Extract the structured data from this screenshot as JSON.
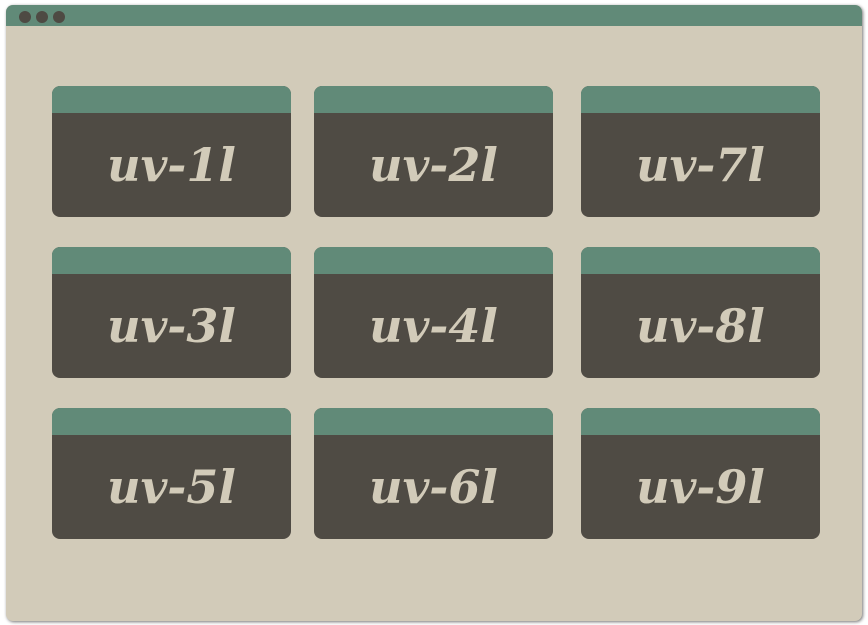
{
  "window": {
    "title_bar_controls": [
      "window-dot",
      "window-dot",
      "window-dot"
    ]
  },
  "tiles": [
    {
      "label": "uv-1l"
    },
    {
      "label": "uv-2l"
    },
    {
      "label": "uv-7l"
    },
    {
      "label": "uv-3l"
    },
    {
      "label": "uv-4l"
    },
    {
      "label": "uv-8l"
    },
    {
      "label": "uv-5l"
    },
    {
      "label": "uv-6l"
    },
    {
      "label": "uv-9l"
    }
  ],
  "colors": {
    "background": "#d2cbb9",
    "accent": "#618a78",
    "tile": "#4f4b44",
    "tile_text": "#d2cbb9"
  }
}
